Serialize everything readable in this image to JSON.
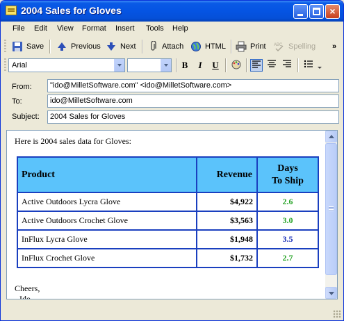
{
  "window": {
    "title": "2004 Sales for Gloves",
    "close_glyph": "×"
  },
  "menu": {
    "file": "File",
    "edit": "Edit",
    "view": "View",
    "format": "Format",
    "insert": "Insert",
    "tools": "Tools",
    "help": "Help"
  },
  "toolbar": {
    "save": "Save",
    "previous": "Previous",
    "next": "Next",
    "attach": "Attach",
    "html": "HTML",
    "print": "Print",
    "spelling": "Spelling",
    "overflow": "»"
  },
  "format": {
    "font_name": "Arial",
    "font_size": "",
    "bold": "B",
    "italic": "I",
    "underline": "U"
  },
  "header": {
    "from_label": "From:",
    "from_value": "\"ido@MilletSoftware.com\" <ido@MilletSoftware.com>",
    "to_label": "To:",
    "to_value": "ido@MilletSoftware.com",
    "subject_label": "Subject:",
    "subject_value": "2004 Sales for Gloves"
  },
  "message": {
    "intro": "Here is 2004 sales data for Gloves:",
    "table": {
      "headers": {
        "product": "Product",
        "revenue": "Revenue",
        "days_line1": "Days",
        "days_line2": "To Ship"
      },
      "rows": [
        {
          "product": "Active Outdoors Lycra Glove",
          "revenue": "$4,922",
          "days": "2.6",
          "days_color": "#2aa52a"
        },
        {
          "product": "Active Outdoors Crochet Glove",
          "revenue": "$3,563",
          "days": "3.0",
          "days_color": "#2aa52a"
        },
        {
          "product": "InFlux Lycra Glove",
          "revenue": "$1,948",
          "days": "3.5",
          "days_color": "#1a2fb8"
        },
        {
          "product": "InFlux Crochet Glove",
          "revenue": "$1,732",
          "days": "2.7",
          "days_color": "#2aa52a"
        }
      ]
    },
    "closing_line1": "Cheers,",
    "closing_line2": "- Ido"
  },
  "colors": {
    "table_header_bg": "#5bc3fb",
    "table_border": "#1a3fbf",
    "titlebar": "#0554e3"
  }
}
